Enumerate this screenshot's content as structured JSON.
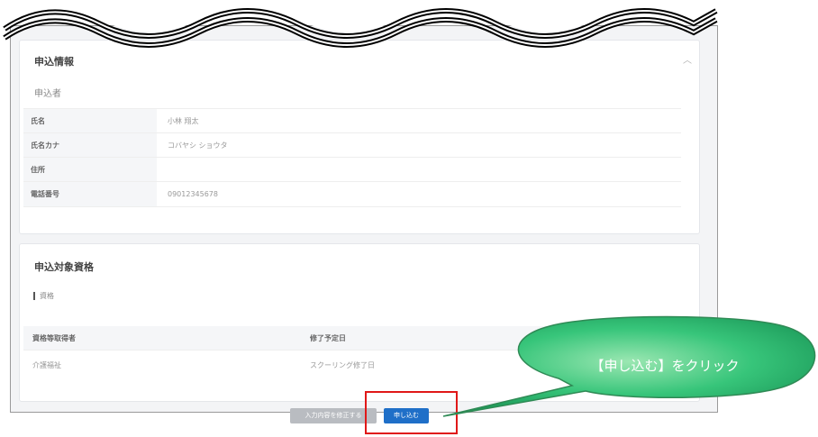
{
  "applicant_section": {
    "title": "申込情報",
    "subtitle": "申込者",
    "rows": [
      {
        "label": "氏名",
        "value": "小林 翔太"
      },
      {
        "label": "氏名カナ",
        "value": "コバヤシ ショウタ"
      },
      {
        "label": "住所",
        "value": ""
      },
      {
        "label": "電話番号",
        "value": "09012345678"
      }
    ]
  },
  "target_section": {
    "title": "申込対象資格",
    "group_label": "資格",
    "columns": [
      "資格等取得者",
      "修了予定日"
    ],
    "rows": [
      {
        "qualification": "介護福祉",
        "date": "スクーリング修了日"
      }
    ]
  },
  "buttons": {
    "back_label": "入力内容を修正する",
    "apply_label": "申し込む"
  },
  "callout": {
    "text": "【申し込む】をクリック"
  }
}
